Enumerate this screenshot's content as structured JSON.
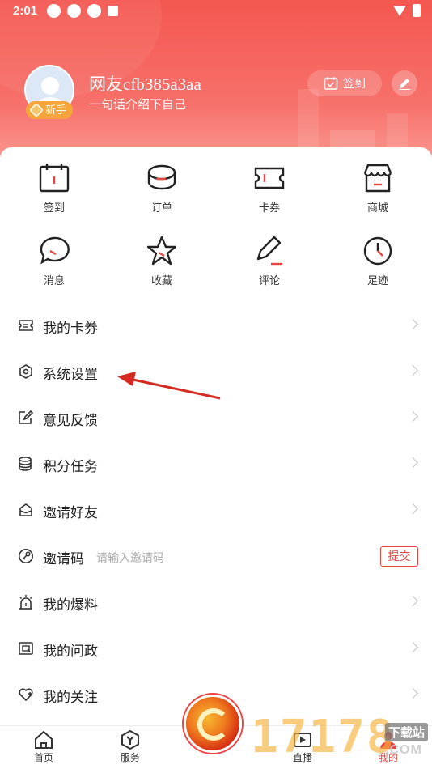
{
  "status_bar": {
    "time": "2:01"
  },
  "profile": {
    "username": "网友cfb385a3aa",
    "bio": "一句话介绍下自己",
    "level_badge": "新手",
    "checkin_label": "签到"
  },
  "grid": {
    "items": [
      {
        "label": "签到",
        "icon": "calendar-icon"
      },
      {
        "label": "订单",
        "icon": "order-icon"
      },
      {
        "label": "卡券",
        "icon": "ticket-icon"
      },
      {
        "label": "商城",
        "icon": "shop-icon"
      },
      {
        "label": "消息",
        "icon": "message-icon"
      },
      {
        "label": "收藏",
        "icon": "star-icon"
      },
      {
        "label": "评论",
        "icon": "pen-icon"
      },
      {
        "label": "足迹",
        "icon": "clock-icon"
      }
    ]
  },
  "menu": {
    "items": [
      {
        "label": "我的卡券",
        "icon": "ticket-icon"
      },
      {
        "label": "系统设置",
        "icon": "settings-icon"
      },
      {
        "label": "意见反馈",
        "icon": "feedback-icon"
      },
      {
        "label": "积分任务",
        "icon": "coins-icon"
      },
      {
        "label": "邀请好友",
        "icon": "invite-icon"
      },
      {
        "label": "邀请码",
        "icon": "key-icon",
        "placeholder": "请输入邀请码",
        "action": "提交"
      },
      {
        "label": "我的爆料",
        "icon": "alarm-icon"
      },
      {
        "label": "我的问政",
        "icon": "question-icon"
      },
      {
        "label": "我的关注",
        "icon": "heart-icon"
      }
    ]
  },
  "bottom_nav": {
    "items": [
      {
        "label": "首页",
        "icon": "home-icon"
      },
      {
        "label": "服务",
        "icon": "service-icon"
      },
      {
        "label": "直播",
        "icon": "live-icon"
      },
      {
        "label": "我的",
        "icon": "user-icon"
      }
    ]
  },
  "watermark": {
    "text": "17178",
    "site": "下载站",
    "domain": ".COM"
  },
  "colors": {
    "accent": "#e5463f",
    "header_start": "#f4574f",
    "header_end": "#fba79f"
  }
}
